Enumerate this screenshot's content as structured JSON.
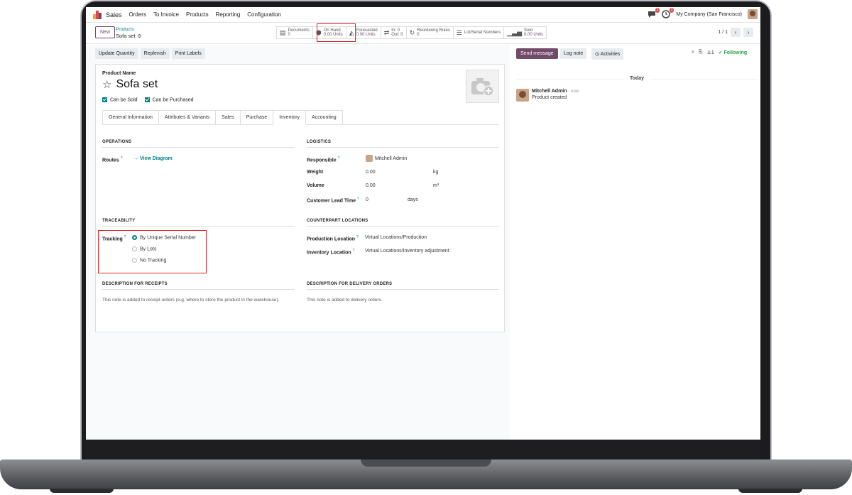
{
  "navbar": {
    "app_name": "Sales",
    "menu": [
      "Orders",
      "To Invoice",
      "Products",
      "Reporting",
      "Configuration"
    ],
    "company": "My Company (San Francisco)",
    "messages_count": "1",
    "activities_count": "1"
  },
  "control_panel": {
    "new_label": "New",
    "breadcrumb_parent": "Products",
    "breadcrumb_current": "Sofa set",
    "pager": "1 / 1"
  },
  "smart_buttons": [
    {
      "icon": "document-icon",
      "label": "Documents",
      "value": "0"
    },
    {
      "icon": "cubes-icon",
      "label": "On Hand",
      "value": "0.00 Units"
    },
    {
      "icon": "chart-area-icon",
      "label": "Forecasted",
      "value": "0.00 Units"
    },
    {
      "icon": "exchange-icon",
      "label": "In: 0",
      "value": "Out: 0"
    },
    {
      "icon": "refresh-icon",
      "label": "Reordering Rules",
      "value": "0"
    },
    {
      "icon": "list-icon",
      "label": "Lot/Serial Numbers",
      "value": ""
    },
    {
      "icon": "signal-icon",
      "label": "Sold",
      "value": "0.00 Units"
    }
  ],
  "actions": [
    "Update Quantity",
    "Replenish",
    "Print Labels"
  ],
  "product": {
    "name_label": "Product Name",
    "name": "Sofa set",
    "can_be_sold": "Can be Sold",
    "can_be_purchased": "Can be Purchased"
  },
  "tabs": [
    "General Information",
    "Attributes & Variants",
    "Sales",
    "Purchase",
    "Inventory",
    "Accounting"
  ],
  "active_tab": "Inventory",
  "inventory": {
    "operations_title": "OPERATIONS",
    "routes_label": "Routes",
    "routes_link": "View Diagram",
    "logistics_title": "LOGISTICS",
    "responsible_label": "Responsible",
    "responsible_value": "Mitchell Admin",
    "weight_label": "Weight",
    "weight_value": "0.00",
    "weight_unit": "kg",
    "volume_label": "Volume",
    "volume_value": "0.00",
    "volume_unit": "m³",
    "lead_time_label": "Customer Lead Time",
    "lead_time_value": "0",
    "lead_time_unit": "days",
    "traceability_title": "TRACEABILITY",
    "tracking_label": "Tracking",
    "tracking_options": [
      "By Unique Serial Number",
      "By Lots",
      "No Tracking"
    ],
    "tracking_selected": 0,
    "counterpart_title": "COUNTERPART LOCATIONS",
    "production_label": "Production Location",
    "production_value": "Virtual Locations/Production",
    "inventory_loc_label": "Inventory Location",
    "inventory_loc_value": "Virtual Locations/Inventory adjustment",
    "receipts_title": "DESCRIPTION FOR RECEIPTS",
    "receipts_hint": "This note is added to receipt orders (e.g. where to store the product in the warehouse).",
    "delivery_title": "DESCRIPTION FOR DELIVERY ORDERS",
    "delivery_hint": "This note is added to delivery orders."
  },
  "chatter": {
    "send_message": "Send message",
    "log_note": "Log note",
    "activities": "Activities",
    "followers_count": "1",
    "following": "Following",
    "today": "Today",
    "author": "Mitchell Admin",
    "time": "- now",
    "body": "Product created"
  },
  "colors": {
    "brand": "#714b67",
    "accent": "#017e84",
    "highlight": "#e02020"
  }
}
